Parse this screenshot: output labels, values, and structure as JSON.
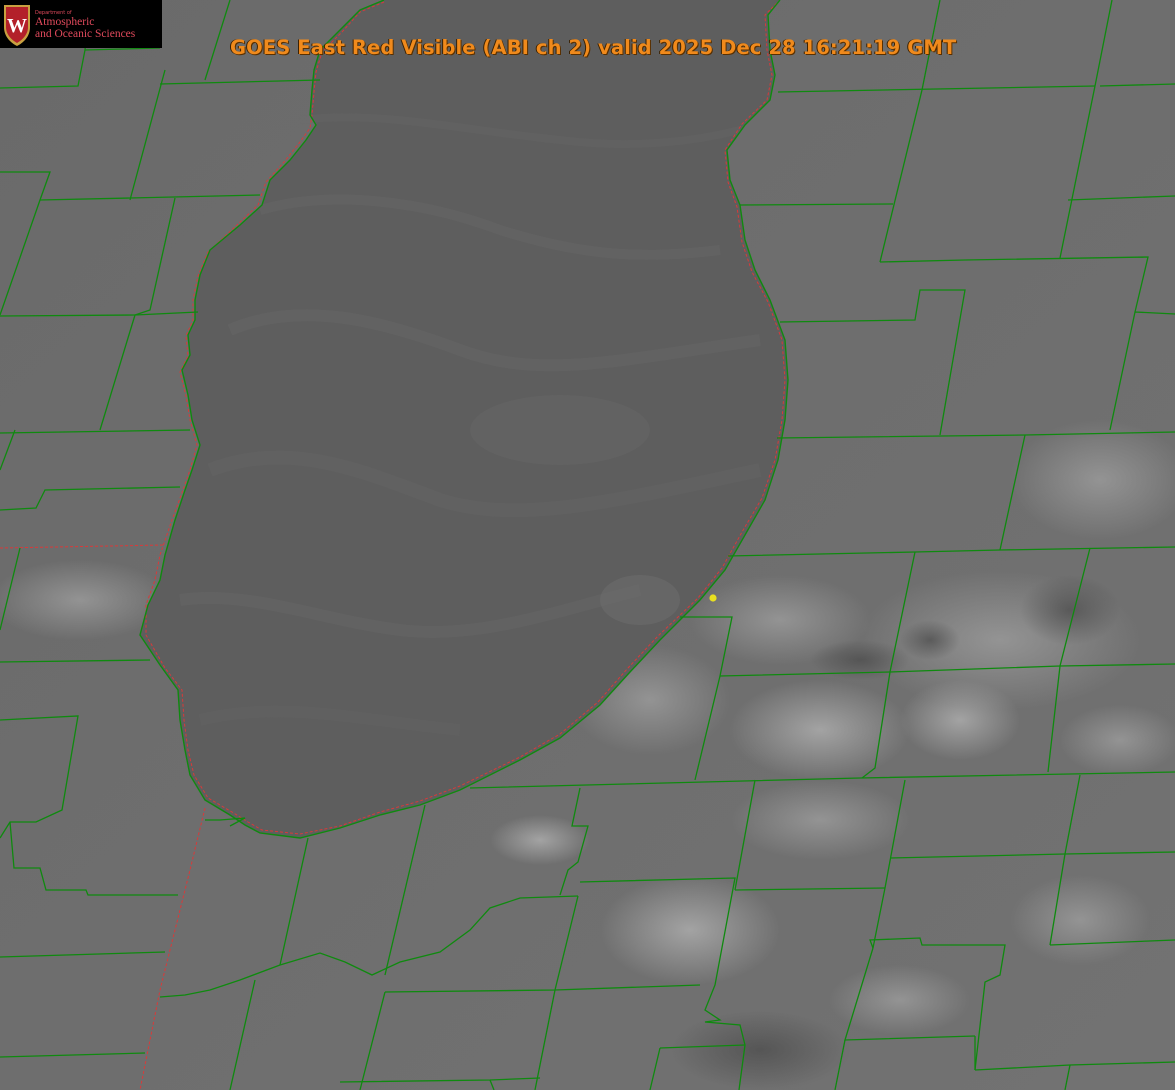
{
  "title": "GOES East Red Visible (ABI ch 2) valid 2025 Dec 28 16:21:19 GMT",
  "logo": {
    "line_small": "Department of",
    "line_1": "Atmospheric",
    "line_2": "and Oceanic Sciences",
    "emblem_letter": "W"
  },
  "colors": {
    "title": "#f08a1c",
    "county_lines": "#0f8a0f",
    "coastline_dashed": "#d83a3a",
    "marker": "#e8e020",
    "logo_text": "#e04a5c",
    "crest_red": "#b3202a",
    "crest_gold": "#c8a040"
  },
  "marker": {
    "name": "location-marker"
  }
}
